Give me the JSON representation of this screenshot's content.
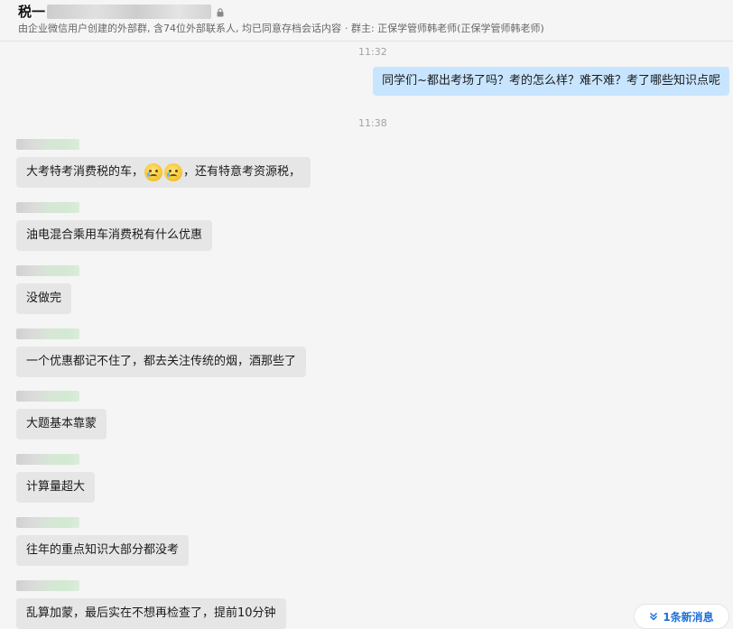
{
  "header": {
    "title": "税一",
    "subtitle": "由企业微信用户创建的外部群, 含74位外部联系人, 均已同意存档会话内容",
    "owner": "· 群主: 正保学管师韩老师(正保学管师韩老师)"
  },
  "timestamps": [
    "11:32",
    "11:38"
  ],
  "outgoing": {
    "text": "同学们~都出考场了吗？考的怎么样？难不难？考了哪些知识点呢"
  },
  "messages": [
    {
      "before": "大考特考消费税的车，",
      "after": "，还有特意考资源税，"
    },
    {
      "text": "油电混合乘用车消费税有什么优惠"
    },
    {
      "text": "没做完"
    },
    {
      "text": "一个优惠都记不住了，都去关注传统的烟，酒那些了"
    },
    {
      "text": "大题基本靠蒙"
    },
    {
      "text": "计算量超大"
    },
    {
      "text": "往年的重点知识大部分都没考"
    },
    {
      "text": "乱算加蒙，最后实在不想再检查了，提前10分钟"
    }
  ],
  "new_messages_label": "1条新消息",
  "icons": {
    "lock": "lock-icon",
    "emoji": "crying-face-emoji",
    "new_messages": "double-chevron-down-icon"
  },
  "colors": {
    "outgoing_bubble": "#c8e5ff",
    "incoming_bubble": "#e6e6e6",
    "link_blue": "#1d6fd6"
  }
}
